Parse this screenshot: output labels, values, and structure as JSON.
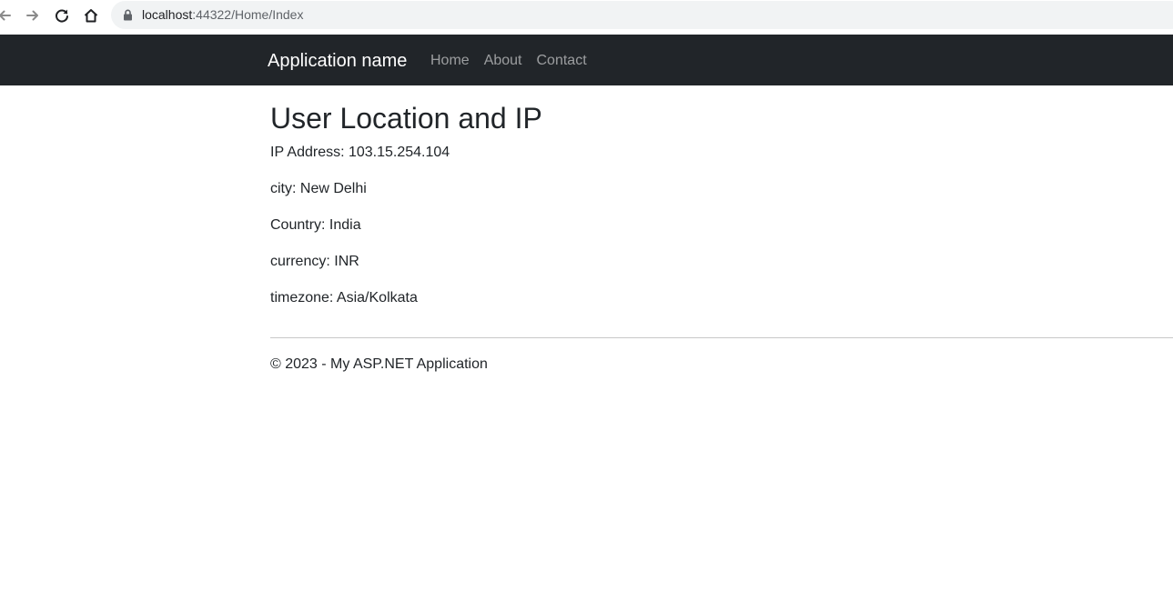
{
  "browser": {
    "url_host": "localhost",
    "url_rest": ":44322/Home/Index",
    "icons": [
      "back-arrow-icon",
      "forward-arrow-icon",
      "reload-icon",
      "home-icon",
      "lock-icon"
    ]
  },
  "navbar": {
    "brand": "Application name",
    "links": [
      "Home",
      "About",
      "Contact"
    ],
    "background": "#212529"
  },
  "main": {
    "title": "User Location and IP",
    "ip_line": "IP Address: 103.15.254.104",
    "city_line": "city: New Delhi",
    "country_line": "Country: India",
    "currency_line": "currency: INR",
    "timezone_line": "timezone: Asia/Kolkata"
  },
  "footer": {
    "text": "© 2023 - My ASP.NET Application"
  }
}
